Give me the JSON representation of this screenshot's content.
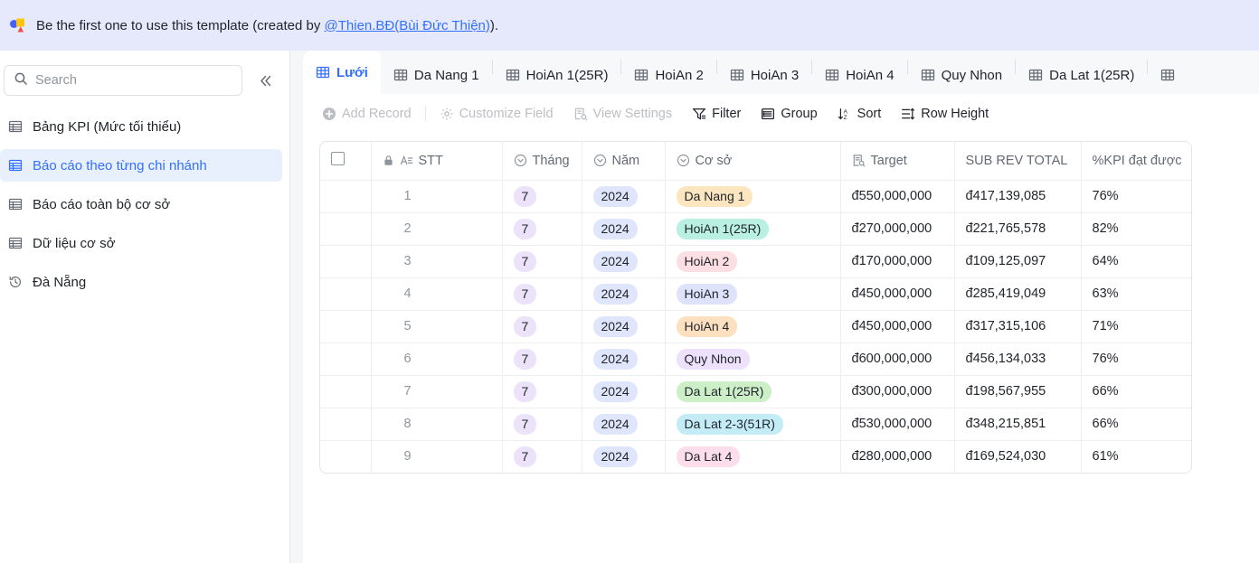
{
  "banner": {
    "icon": "app-logo-icon",
    "text_before": "Be the first one to use this template (created by ",
    "link": "@Thien.BĐ(Bùi Đức Thiện)",
    "text_after": ").",
    "bg_color": "#e6e9fb",
    "link_color": "#3370ff"
  },
  "sidebar": {
    "search": {
      "placeholder": "Search",
      "value": "",
      "icon": "search-icon"
    },
    "collapse_icon": "collapse-left-icon",
    "items": [
      {
        "label": "Bảng KPI (Mức tối thiểu)",
        "icon": "table-icon",
        "active": false
      },
      {
        "label": "Báo cáo theo từng chi nhánh",
        "icon": "table-icon",
        "active": true
      },
      {
        "label": "Báo cáo toàn bộ cơ sở",
        "icon": "table-icon",
        "active": false
      },
      {
        "label": "Dữ liệu cơ sở",
        "icon": "table-icon",
        "active": false
      },
      {
        "label": "Đà Nẵng",
        "icon": "history-clock-icon",
        "active": false
      }
    ],
    "active_color": "#3370ff",
    "active_bg": "#e8f0fe"
  },
  "tabs": [
    {
      "label": "Lưới",
      "icon": "grid-icon",
      "active": true
    },
    {
      "label": "Da Nang 1",
      "icon": "grid-icon",
      "active": false
    },
    {
      "label": "HoiAn 1(25R)",
      "icon": "grid-icon",
      "active": false
    },
    {
      "label": "HoiAn 2",
      "icon": "grid-icon",
      "active": false
    },
    {
      "label": "HoiAn 3",
      "icon": "grid-icon",
      "active": false
    },
    {
      "label": "HoiAn 4",
      "icon": "grid-icon",
      "active": false
    },
    {
      "label": "Quy Nhon",
      "icon": "grid-icon",
      "active": false
    },
    {
      "label": "Da Lat 1(25R)",
      "icon": "grid-icon",
      "active": false
    }
  ],
  "toolbar": [
    {
      "label": "Add Record",
      "icon": "plus-circle-icon",
      "disabled": true
    },
    {
      "label": "Customize Field",
      "icon": "gear-icon",
      "disabled": true
    },
    {
      "label": "View Settings",
      "icon": "view-settings-icon",
      "disabled": true
    },
    {
      "label": "Filter",
      "icon": "filter-icon",
      "disabled": false
    },
    {
      "label": "Group",
      "icon": "group-icon",
      "disabled": false
    },
    {
      "label": "Sort",
      "icon": "sort-az-icon",
      "disabled": false
    },
    {
      "label": "Row Height",
      "icon": "row-height-icon",
      "disabled": false
    }
  ],
  "table": {
    "columns": [
      {
        "label": "",
        "icon": "checkbox-icon",
        "key": "check"
      },
      {
        "label": "STT",
        "icon": "text-field-icon",
        "locked": true,
        "key": "stt"
      },
      {
        "label": "Tháng",
        "icon": "select-icon",
        "key": "thang"
      },
      {
        "label": "Năm",
        "icon": "select-icon",
        "key": "nam"
      },
      {
        "label": "Cơ sở",
        "icon": "select-icon",
        "key": "coso"
      },
      {
        "label": "Target",
        "icon": "lookup-icon",
        "key": "target"
      },
      {
        "label": "SUB REV TOTAL",
        "icon": "",
        "key": "sub"
      },
      {
        "label": "%KPI đạt được",
        "icon": "",
        "key": "kpi"
      }
    ],
    "rows": [
      {
        "stt": "1",
        "thang": "7",
        "nam": "2024",
        "coso": "Da Nang 1",
        "coso_bg": "#fbe6c0",
        "target": "đ550,000,000",
        "sub": "đ417,139,085",
        "kpi": "76%"
      },
      {
        "stt": "2",
        "thang": "7",
        "nam": "2024",
        "coso": "HoiAn 1(25R)",
        "coso_bg": "#b9f0e2",
        "target": "đ270,000,000",
        "sub": "đ221,765,578",
        "kpi": "82%"
      },
      {
        "stt": "3",
        "thang": "7",
        "nam": "2024",
        "coso": "HoiAn 2",
        "coso_bg": "#fbdfe2",
        "target": "đ170,000,000",
        "sub": "đ109,125,097",
        "kpi": "64%"
      },
      {
        "stt": "4",
        "thang": "7",
        "nam": "2024",
        "coso": "HoiAn 3",
        "coso_bg": "#dfe2fb",
        "target": "đ450,000,000",
        "sub": "đ285,419,049",
        "kpi": "63%"
      },
      {
        "stt": "5",
        "thang": "7",
        "nam": "2024",
        "coso": "HoiAn 4",
        "coso_bg": "#fde0c0",
        "target": "đ450,000,000",
        "sub": "đ317,315,106",
        "kpi": "71%"
      },
      {
        "stt": "6",
        "thang": "7",
        "nam": "2024",
        "coso": "Quy Nhon",
        "coso_bg": "#ede1fb",
        "target": "đ600,000,000",
        "sub": "đ456,134,033",
        "kpi": "76%"
      },
      {
        "stt": "7",
        "thang": "7",
        "nam": "2024",
        "coso": "Da Lat 1(25R)",
        "coso_bg": "#cdefc8",
        "target": "đ300,000,000",
        "sub": "đ198,567,955",
        "kpi": "66%"
      },
      {
        "stt": "8",
        "thang": "7",
        "nam": "2024",
        "coso": "Da Lat 2-3(51R)",
        "coso_bg": "#c4ecf6",
        "target": "đ530,000,000",
        "sub": "đ348,215,851",
        "kpi": "66%"
      },
      {
        "stt": "9",
        "thang": "7",
        "nam": "2024",
        "coso": "Da Lat 4",
        "coso_bg": "#fbdeea",
        "target": "đ280,000,000",
        "sub": "đ169,524,030",
        "kpi": "61%"
      }
    ],
    "chip_thang_bg": "#ece3fb",
    "chip_nam_bg": "#dfe6fb"
  }
}
